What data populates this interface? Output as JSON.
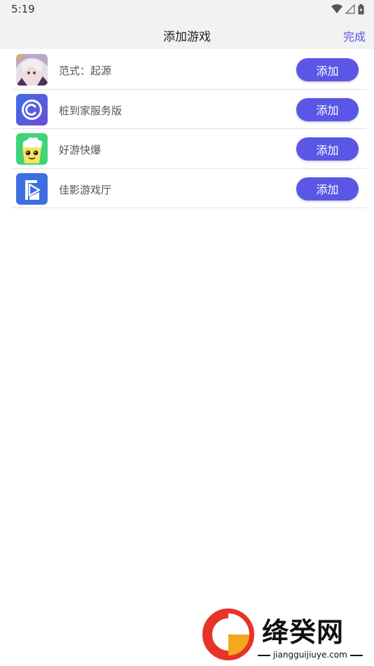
{
  "status_bar": {
    "time": "5:19"
  },
  "header": {
    "title": "添加游戏",
    "done_label": "完成"
  },
  "games": [
    {
      "name": "范式：起源",
      "add_label": "添加",
      "icon": "anime-character-icon"
    },
    {
      "name": "桩到家服务版",
      "add_label": "添加",
      "icon": "blue-c-logo-icon"
    },
    {
      "name": "好游快爆",
      "add_label": "添加",
      "icon": "popcorn-face-icon"
    },
    {
      "name": "佳影游戏厅",
      "add_label": "添加",
      "icon": "blue-play-logo-icon"
    }
  ],
  "watermark": {
    "brand": "绛癸网",
    "url": "jiangguijiuye.com"
  },
  "colors": {
    "accent": "#5a56e6",
    "header_bg": "#f2f2f2",
    "divider": "#e3e3e3"
  }
}
